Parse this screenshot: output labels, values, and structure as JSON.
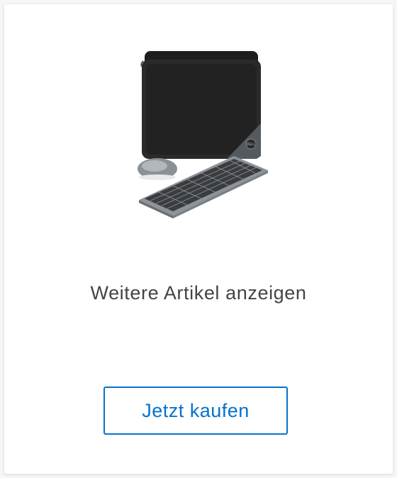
{
  "card": {
    "title": "Weitere Artikel anzeigen",
    "button_label": "Jetzt kaufen",
    "image_brand_text": "DELL"
  },
  "colors": {
    "accent": "#0672cb",
    "title_text": "#444444",
    "background": "#f5f6f7",
    "card": "#ffffff"
  },
  "icons": {
    "product": "laptop-sleeve-mouse-keyboard-image"
  }
}
